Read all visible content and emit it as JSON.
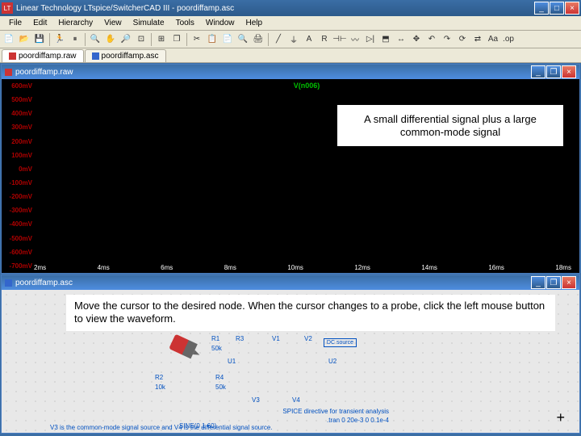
{
  "app": {
    "title": "Linear Technology LTspice/SwitcherCAD III - poordiffamp.asc"
  },
  "menu": {
    "items": [
      "File",
      "Edit",
      "Hierarchy",
      "View",
      "Simulate",
      "Tools",
      "Window",
      "Help"
    ]
  },
  "tabs": {
    "items": [
      {
        "label": "poordiffamp.raw",
        "type": "raw",
        "active": true
      },
      {
        "label": "poordiffamp.asc",
        "type": "asc",
        "active": false
      }
    ]
  },
  "waveform": {
    "title": "poordiffamp.raw",
    "signal": "V(n006)",
    "y_labels": [
      "600mV",
      "500mV",
      "400mV",
      "300mV",
      "200mV",
      "100mV",
      "0mV",
      "-100mV",
      "-200mV",
      "-300mV",
      "-400mV",
      "-500mV",
      "-600mV",
      "-700mV"
    ],
    "x_labels": [
      "2ms",
      "4ms",
      "6ms",
      "8ms",
      "10ms",
      "12ms",
      "14ms",
      "16ms",
      "18ms"
    ],
    "annotation": "A small differential signal plus a large common-mode signal"
  },
  "schematic": {
    "title": "poordiffamp.asc",
    "instruction": "Move the cursor to the desired node.  When the cursor changes to a probe, click the left mouse button to view the waveform.",
    "components": {
      "r1": "R1",
      "r2": "R2",
      "r3": "R3",
      "r4": "R4",
      "u1": "U1",
      "u2": "U2",
      "v1": "V1",
      "v2": "V2",
      "v3": "V3",
      "v4": "V4",
      "val_10k": "10k",
      "val_50k": "50k",
      "dc_source": "DC source",
      "sine": "SINE(0 1 60)",
      "spice_note": "SPICE directive for transient analysis",
      "spice_cmd": ".tran 0 20e-3 0 0.1e-4",
      "footer": "V3 is the common-mode signal source and V4 is the differential signal source."
    }
  }
}
